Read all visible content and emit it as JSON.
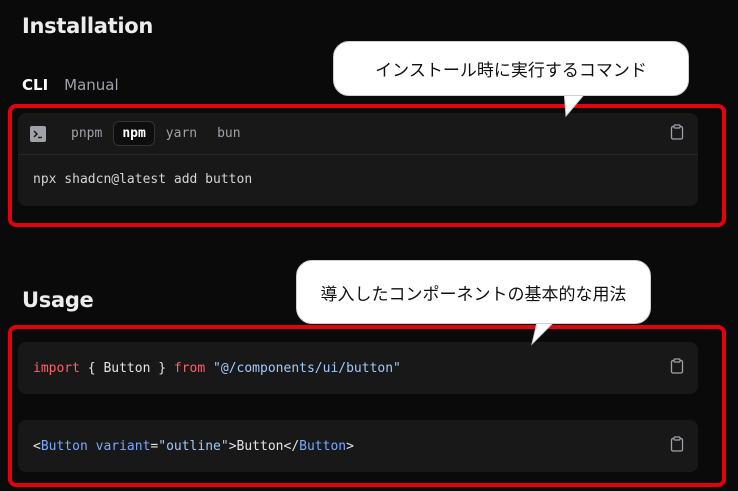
{
  "installation": {
    "title": "Installation",
    "tabs": [
      {
        "label": "CLI",
        "active": true
      },
      {
        "label": "Manual",
        "active": false
      }
    ],
    "package_managers": [
      {
        "label": "pnpm",
        "active": false
      },
      {
        "label": "npm",
        "active": true
      },
      {
        "label": "yarn",
        "active": false
      },
      {
        "label": "bun",
        "active": false
      }
    ],
    "command": "npx shadcn@latest add button"
  },
  "usage": {
    "title": "Usage",
    "code_1": {
      "import": "import",
      "open_brace": " { ",
      "name": "Button",
      "close_brace": " } ",
      "from": "from",
      "space": " ",
      "path": "\"@/components/ui/button\""
    },
    "code_2": {
      "lt": "<",
      "tag": "Button",
      "space": " ",
      "attr": "variant",
      "eq": "=",
      "value": "\"outline\"",
      "gt": ">",
      "text": "Button",
      "close_lt": "</",
      "close_tag": "Button",
      "close_gt": ">"
    }
  },
  "annotations": {
    "bubble_1": "インストール時に実行するコマンド",
    "bubble_2": "導入したコンポーネントの基本的な用法"
  },
  "colors": {
    "highlight_border": "#e5000f",
    "keyword": "#ff5f6d",
    "string": "#9ecbff",
    "tag": "#79a8ff"
  },
  "icons": [
    "terminal-icon",
    "clipboard-icon"
  ]
}
